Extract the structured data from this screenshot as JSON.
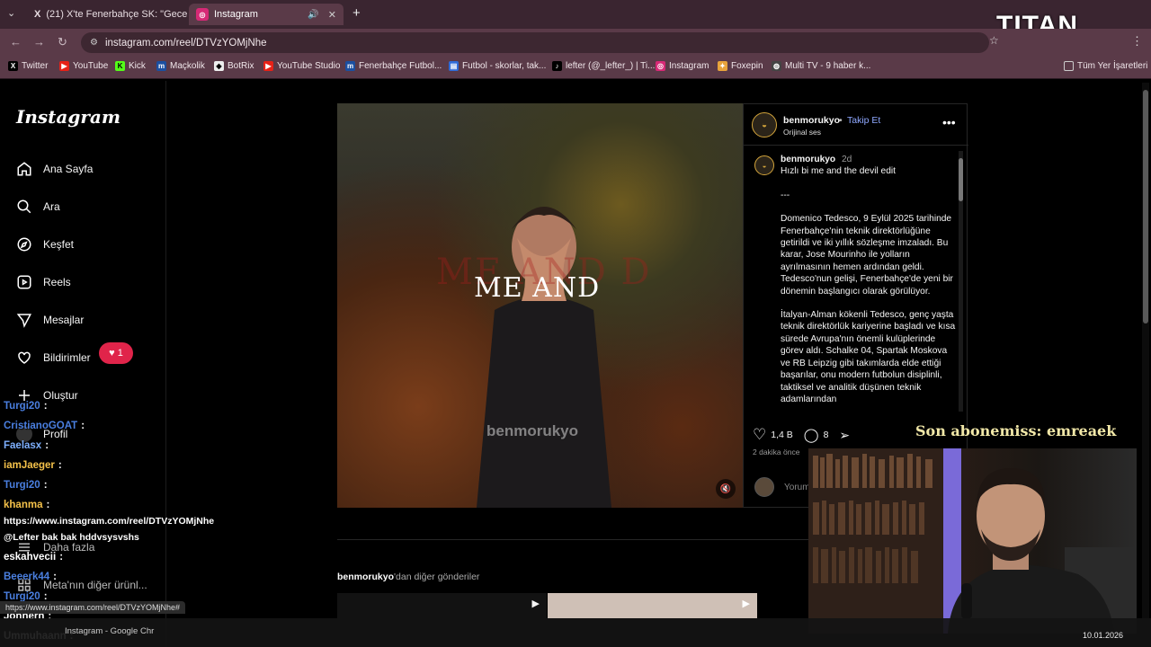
{
  "browser": {
    "tabs": [
      {
        "title": "(21) X'te Fenerbahçe SK: \"Gece",
        "icon": "x-icon",
        "active": false
      },
      {
        "title": "Instagram",
        "icon": "instagram-icon",
        "active": true
      }
    ],
    "url": "instagram.com/reel/DTVzYOMjNhe",
    "bookmarks": [
      "Twitter",
      "YouTube",
      "Kick",
      "Maçkolik",
      "BotRix",
      "YouTube Studio",
      "Fenerbahçe Futbol...",
      "Futbol - skorlar, tak...",
      "lefter (@_lefter_) | Ti...",
      "Instagram",
      "Foxepin",
      "Multi TV - 9 haber k..."
    ],
    "all_bookmarks": "Tüm Yer İşaretleri",
    "hover_url": "https://www.instagram.com/reel/DTVzYOMjNhe#"
  },
  "instagram": {
    "logo": "Instagram",
    "nav": [
      "Ana Sayfa",
      "Ara",
      "Keşfet",
      "Reels",
      "Mesajlar",
      "Bildirimler",
      "Oluştur",
      "Profil",
      "Daha fazla",
      "Meta'nın diğer ürünl..."
    ],
    "notification_count": "1",
    "post": {
      "username": "benmorukyo",
      "follow": "Takip Et",
      "audio": "Orijinal ses",
      "time_ago": "2d",
      "caption_title": "Hızlı bi me and the devil edit",
      "separator": "---",
      "caption_p1": "Domenico Tedesco, 9 Eylül 2025 tarihinde Fenerbahçe'nin teknik direktörlüğüne getirildi ve iki yıllık sözleşme imzaladı. Bu karar, Jose Mourinho ile yolların ayrılmasının hemen ardından geldi. Tedesco'nun gelişi, Fenerbahçe'de yeni bir dönemin başlangıcı olarak görülüyor.",
      "caption_p2": "İtalyan-Alman kökenli Tedesco, genç yaşta teknik direktörlük kariyerine başladı ve kısa sürede Avrupa'nın önemli kulüplerinde görev aldı. Schalke 04, Spartak Moskova ve RB Leipzig gibi takımlarda elde ettiği başarılar, onu modern futbolun disiplinli, taktiksel ve analitik düşünen teknik adamlarından",
      "likes": "1,4 B",
      "comments": "8",
      "posted": "2 dakika önce",
      "comment_placeholder": "Yorum",
      "video_caption": "ME AND",
      "video_bigtext": "ME AND D",
      "video_watermark": "benmorukyo"
    },
    "more_posts_user": "benmorukyo",
    "more_posts_suffix": "'dan diğer gönderiler"
  },
  "stream": {
    "chat": [
      {
        "user": "Turgi20",
        "msg": ":"
      },
      {
        "user": "CristianoGOAT",
        "msg": ":"
      },
      {
        "user": "Faelasx",
        "msg": ":"
      },
      {
        "user": "iamJaeger",
        "msg": ":"
      },
      {
        "user": "Turgi20",
        "msg": ":"
      },
      {
        "user": "khanma",
        "msg": ":"
      },
      {
        "user": "",
        "msg": "https://www.instagram.com/reel/DTVzYOMjNhe"
      },
      {
        "user": "",
        "msg": "@Lefter bak bak hddvsysvshs"
      },
      {
        "user": "eskahvecii",
        "msg": ":"
      },
      {
        "user": "Beeerk44",
        "msg": ":"
      },
      {
        "user": "Turgi20",
        "msg": ":"
      },
      {
        "user": "Johnern",
        "msg": ":"
      },
      {
        "user": "Ummuhaann",
        "msg": ":"
      }
    ],
    "subscriber_text": "Son abonemiss: emreaek",
    "logo_text": "TITAN",
    "taskbar_app": "Instagram - Google Chr",
    "date": "10.01.2026"
  }
}
